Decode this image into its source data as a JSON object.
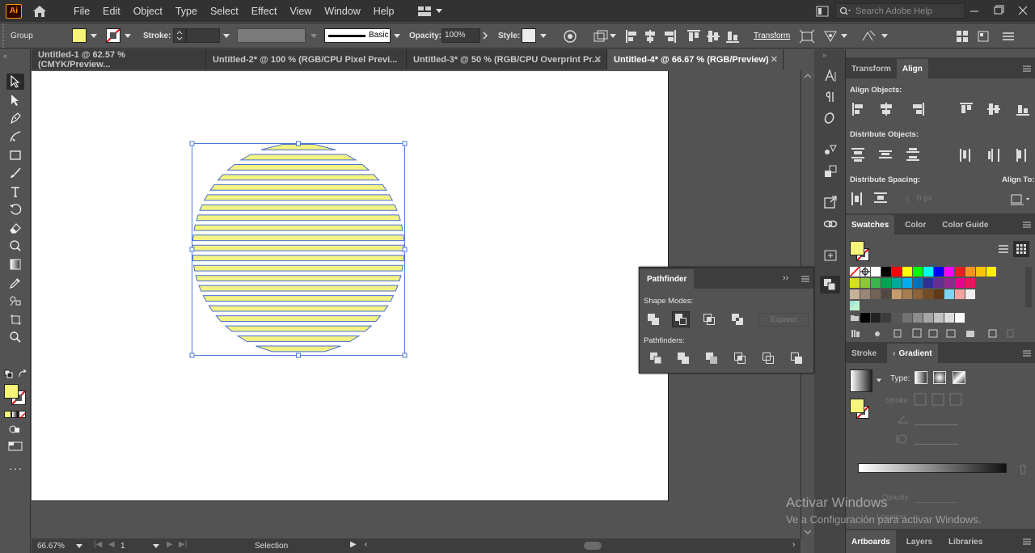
{
  "app": {
    "logo": "Ai"
  },
  "menu": [
    "File",
    "Edit",
    "Object",
    "Type",
    "Select",
    "Effect",
    "View",
    "Window",
    "Help"
  ],
  "search": {
    "placeholder": "Search Adobe Help"
  },
  "control_bar": {
    "selection_type": "Group",
    "fill_color": "#f5f57a",
    "stroke_label": "Stroke:",
    "brush_label": "Basic",
    "opacity_label": "Opacity:",
    "opacity_value": "100%",
    "style_label": "Style:",
    "transform_label": "Transform"
  },
  "doc_tabs": [
    {
      "label": "Untitled-1 @ 62.57 % (CMYK/Preview...",
      "active": false
    },
    {
      "label": "Untitled-2* @ 100 % (RGB/CPU Pixel Previ...",
      "active": false
    },
    {
      "label": "Untitled-3* @ 50 % (RGB/CPU Overprint Pr...",
      "active": false
    },
    {
      "label": "Untitled-4* @ 66.67 % (RGB/Preview)",
      "active": true
    }
  ],
  "artwork": {
    "fill": "#f2f382",
    "stroke": "#4a6fd0",
    "stripe_count": 21,
    "selection_color": "#4a78d8"
  },
  "pathfinder": {
    "title": "Pathfinder",
    "shape_modes_label": "Shape Modes:",
    "pathfinders_label": "Pathfinders:",
    "expand_label": "Expand"
  },
  "align_panel": {
    "tabs": [
      "Transform",
      "Align"
    ],
    "align_objects": "Align Objects:",
    "distribute_objects": "Distribute Objects:",
    "distribute_spacing": "Distribute Spacing:",
    "align_to": "Align To:",
    "spacing_value": "0 px"
  },
  "swatches_panel": {
    "tabs": [
      "Swatches",
      "Color",
      "Color Guide"
    ],
    "row1": [
      "#ffffff",
      "#000000",
      "#ff0000",
      "#ffff00",
      "#00ff00",
      "#00ffff",
      "#0000ff",
      "#ff00ff",
      "#ed1c24",
      "#f7941d",
      "#f7c20b",
      "#fff200"
    ],
    "row2": [
      "#d7df23",
      "#8dc63f",
      "#39b54a",
      "#00a651",
      "#00a99d",
      "#00aeef",
      "#0072bc",
      "#2e3192",
      "#662d91",
      "#92278f",
      "#ec008c",
      "#ed145b"
    ],
    "row3": [
      "#c7b299",
      "#998675",
      "#736357",
      "#534741",
      "#c69c6d",
      "#a67c52",
      "#8c6239",
      "#754c24",
      "#603813",
      "#7fd3f0",
      "#f4a3a3",
      "#eeeeee"
    ],
    "grays": [
      "#000000",
      "#222222",
      "#3c3c3c",
      "#575757",
      "#727272",
      "#8c8c8c",
      "#a6a6a6",
      "#c2c2c2",
      "#dcdcdc",
      "#ffffff"
    ]
  },
  "gradient_panel": {
    "tabs": [
      "Stroke",
      "Gradient"
    ],
    "type_label": "Type:",
    "stroke_label": "Stroke:",
    "opacity_label": "Opacity:",
    "location_label": "Location:"
  },
  "bottom_tabs": [
    "Artboards",
    "Layers",
    "Libraries"
  ],
  "status": {
    "zoom": "66.67%",
    "artboard_num": "1",
    "tool": "Selection"
  },
  "watermark": {
    "line1": "Activar Windows",
    "line2": "Ve a Configuración para activar Windows."
  }
}
